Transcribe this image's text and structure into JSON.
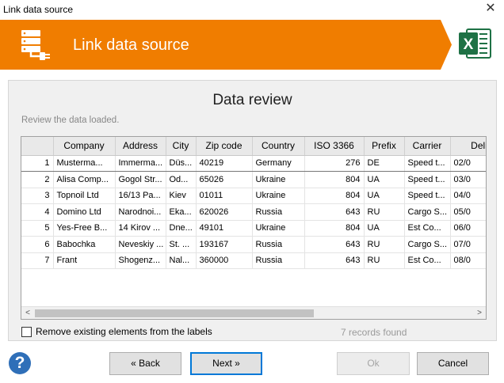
{
  "window": {
    "title": "Link data source",
    "close_symbol": "✕"
  },
  "banner": {
    "title": "Link data source",
    "excel_letter": "X"
  },
  "review": {
    "title": "Data review",
    "subtitle": "Review the data loaded."
  },
  "table": {
    "columns": [
      "",
      "Company",
      "Address",
      "City",
      "Zip code",
      "Country",
      "ISO 3366",
      "Prefix",
      "Carrier",
      "Deliv"
    ],
    "rows": [
      [
        "1",
        "Musterma...",
        "Immerma...",
        "Düs...",
        "40219",
        "Germany",
        "276",
        "DE",
        "Speed t...",
        "02/0"
      ],
      [
        "2",
        "Alisa Comp...",
        "Gogol Str...",
        "Od...",
        "65026",
        "Ukraine",
        "804",
        "UA",
        "Speed t...",
        "03/0"
      ],
      [
        "3",
        "Topnoil Ltd",
        "16/13 Pa...",
        "Kiev",
        "01011",
        "Ukraine",
        "804",
        "UA",
        "Speed t...",
        "04/0"
      ],
      [
        "4",
        "Domino Ltd",
        "Narodnoi...",
        "Eka...",
        "620026",
        "Russia",
        "643",
        "RU",
        "Cargo S...",
        "05/0"
      ],
      [
        "5",
        "Yes-Free B...",
        "14 Kirov ...",
        "Dne...",
        "49101",
        "Ukraine",
        "804",
        "UA",
        "Est Co...",
        "06/0"
      ],
      [
        "6",
        "Babochka",
        "Neveskiy ...",
        "St. ...",
        "193167",
        "Russia",
        "643",
        "RU",
        "Cargo S...",
        "07/0"
      ],
      [
        "7",
        "Frant",
        "Shogenz...",
        "Nal...",
        "360000",
        "Russia",
        "643",
        "RU",
        "Est Co...",
        "08/0"
      ]
    ]
  },
  "scrollbar": {
    "left_arrow": "<",
    "right_arrow": ">"
  },
  "options": {
    "remove_existing_label": "Remove existing elements from the labels",
    "remove_existing_checked": false
  },
  "status": {
    "records_found": "7 records found"
  },
  "buttons": {
    "back": "« Back",
    "next": "Next »",
    "ok": "Ok",
    "cancel": "Cancel",
    "help": "?"
  },
  "colors": {
    "accent": "#f07d00",
    "excel_green": "#1e7145",
    "help_blue": "#2f6fb8",
    "focus_blue": "#0078d7"
  },
  "icons": {
    "banner": "database-plug-icon",
    "excel": "excel-icon",
    "help": "question-icon",
    "close": "close-icon"
  }
}
